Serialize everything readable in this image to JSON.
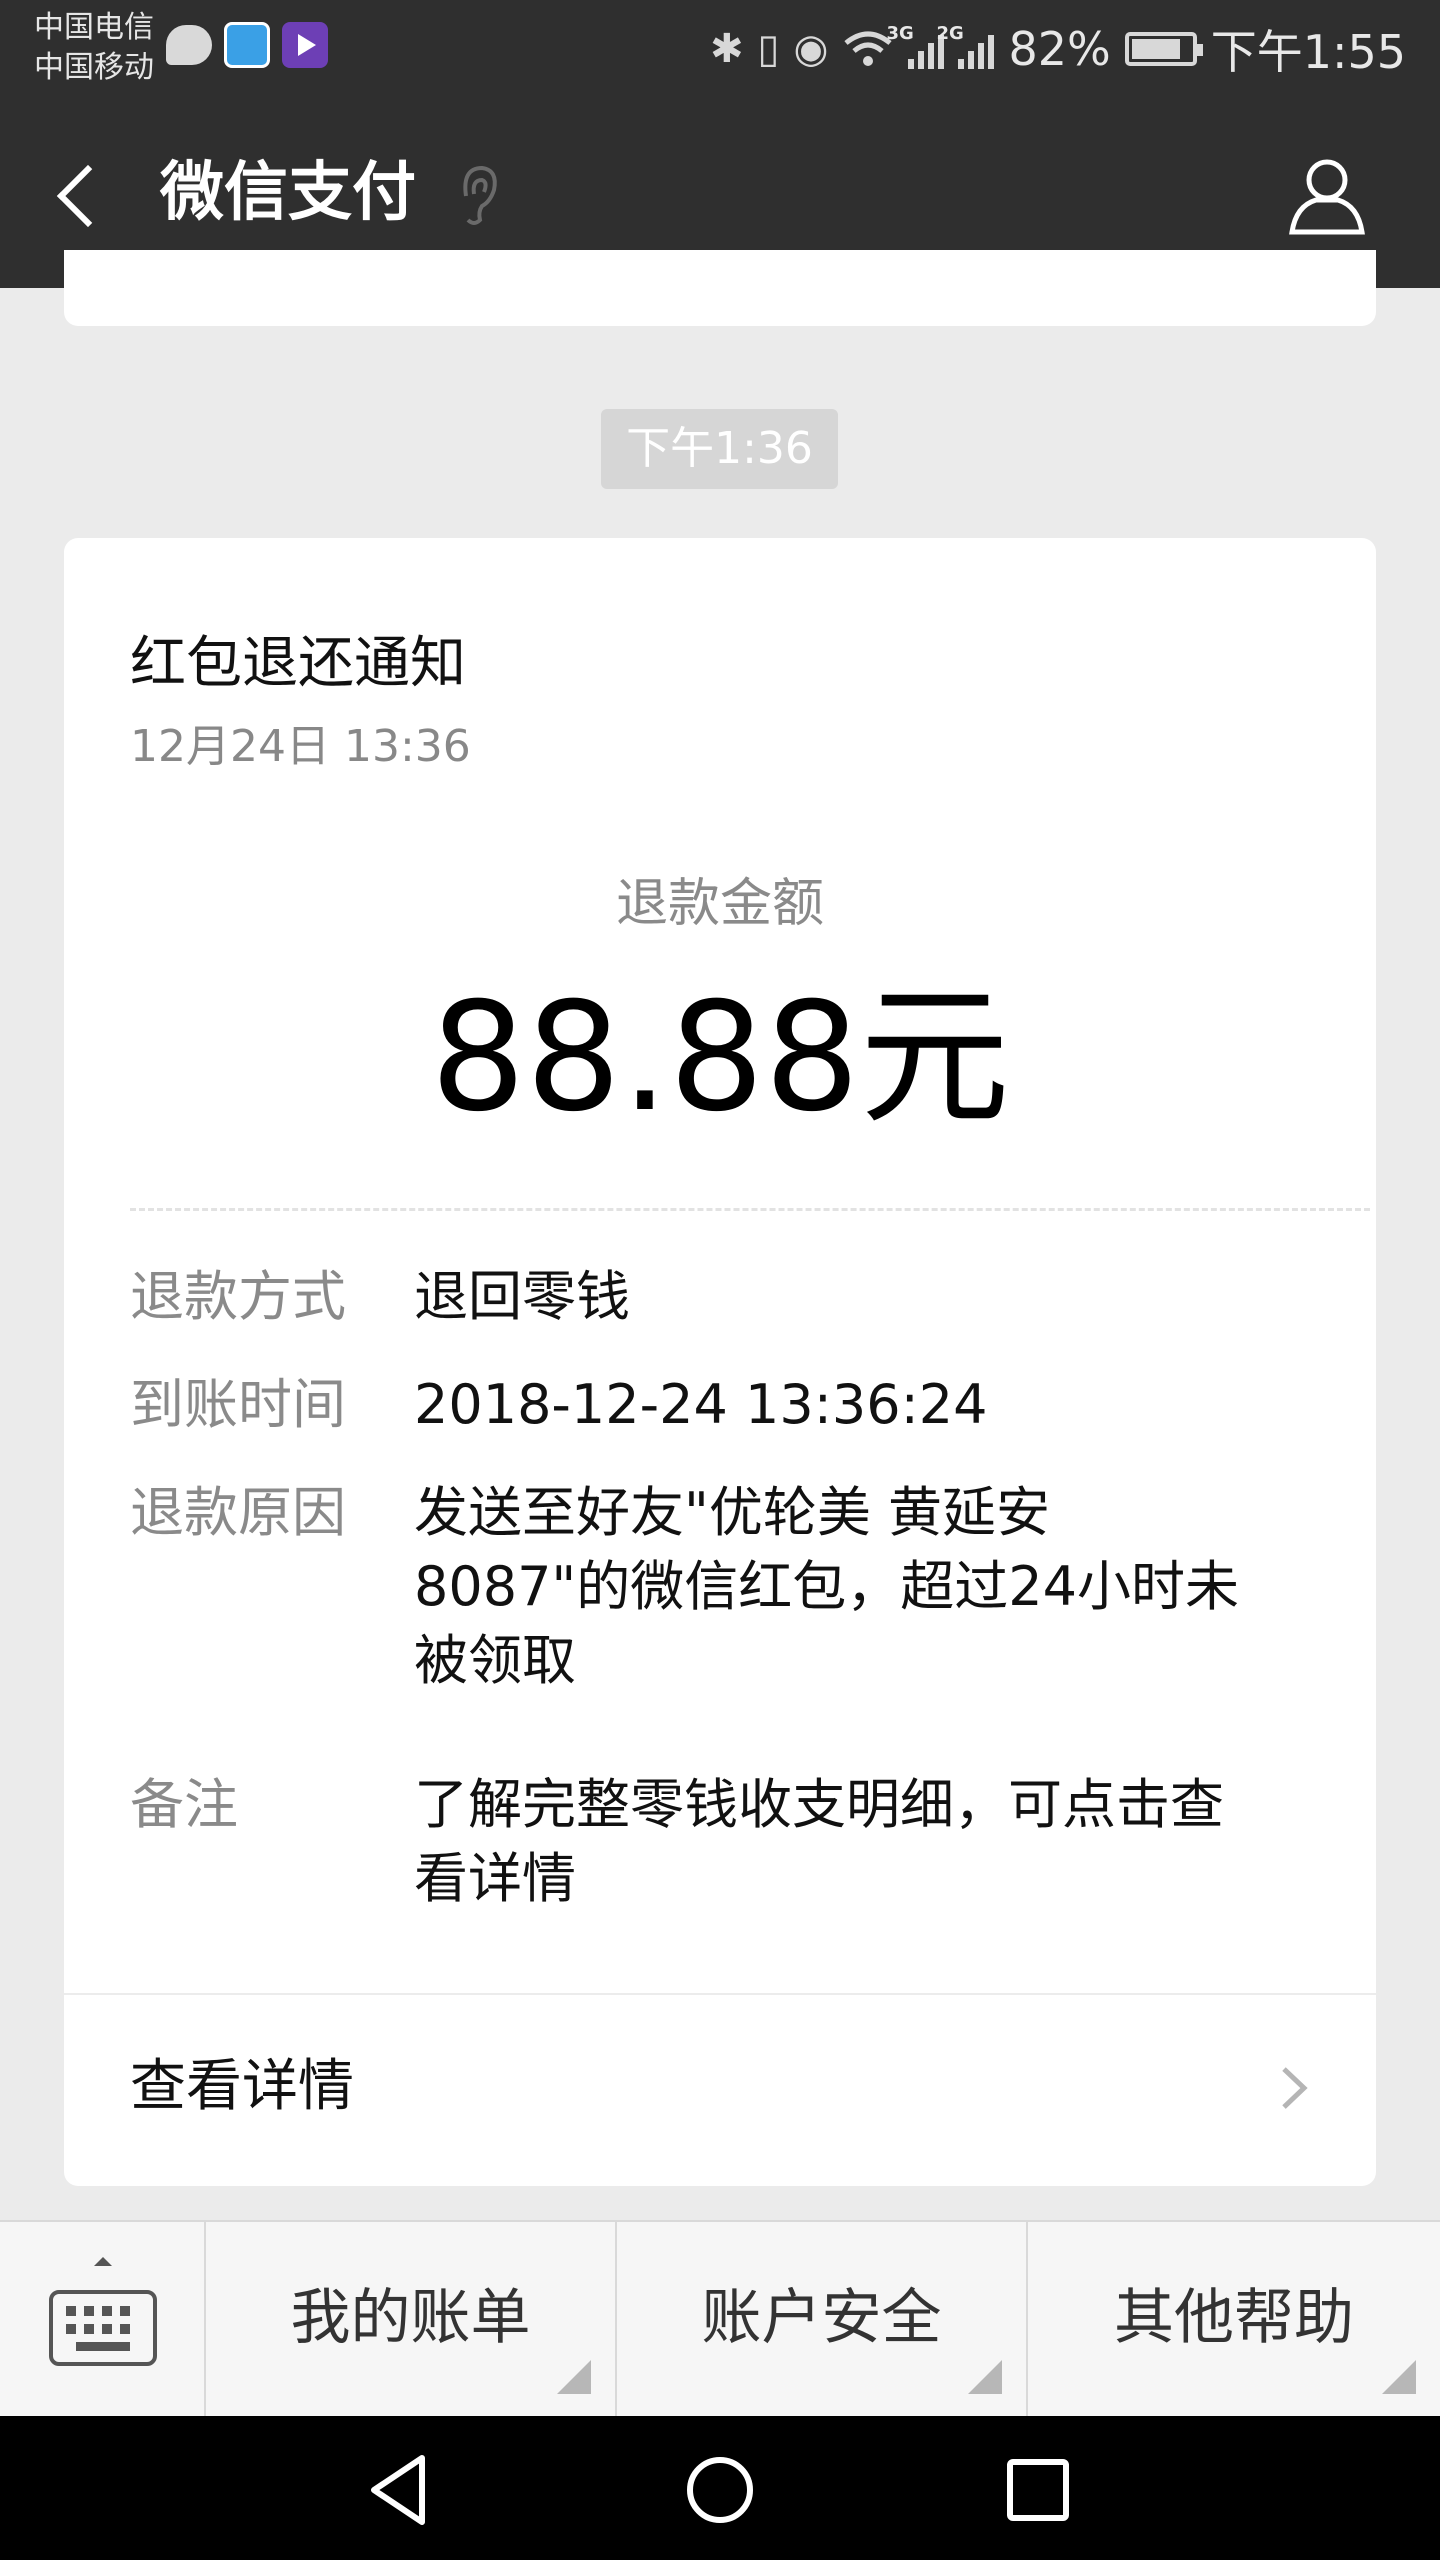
{
  "status_bar": {
    "carrier_1": "中国电信",
    "carrier_2": "中国移动",
    "net_3g": "3G",
    "net_2g": "2G",
    "battery_percent": "82%",
    "battery_level": 0.82,
    "time": "下午1:55",
    "icons": [
      "message-icon",
      "browser-app-icon",
      "video-app-icon",
      "bluetooth-icon",
      "vibrate-icon",
      "eye-care-icon",
      "wifi-icon",
      "signal-icon",
      "battery-icon"
    ]
  },
  "header": {
    "title": "微信支付",
    "icons": [
      "back-icon",
      "ear-icon",
      "user-profile-icon"
    ]
  },
  "message": {
    "time_label": "下午1:36",
    "card": {
      "title": "红包退还通知",
      "date": "12月24日  13:36",
      "amount_label": "退款金额",
      "amount": "88.88元",
      "fields": [
        {
          "key": "退款方式",
          "value_lines": [
            "退回零钱"
          ]
        },
        {
          "key": "到账时间",
          "value_lines": [
            "2018-12-24 13:36:24"
          ]
        },
        {
          "key": "退款原因",
          "value_lines": [
            "发送至好友\"优轮美 黄延安",
            "8087\"的微信红包，超过24小时未",
            "被领取"
          ]
        },
        {
          "key": "备注",
          "value_lines": [
            "了解完整零钱收支明细，可点击查",
            "看详情"
          ]
        }
      ],
      "detail_link": "查看详情"
    }
  },
  "bottom_menu": {
    "items": [
      "我的账单",
      "账户安全",
      "其他帮助"
    ]
  },
  "nav_bar": {
    "icons": [
      "nav-back-icon",
      "nav-home-icon",
      "nav-recents-icon"
    ]
  },
  "colors": {
    "topbar": "#2f2f2f",
    "background": "#ebebeb",
    "card": "#ffffff",
    "muted_text": "#8a8a8a"
  }
}
